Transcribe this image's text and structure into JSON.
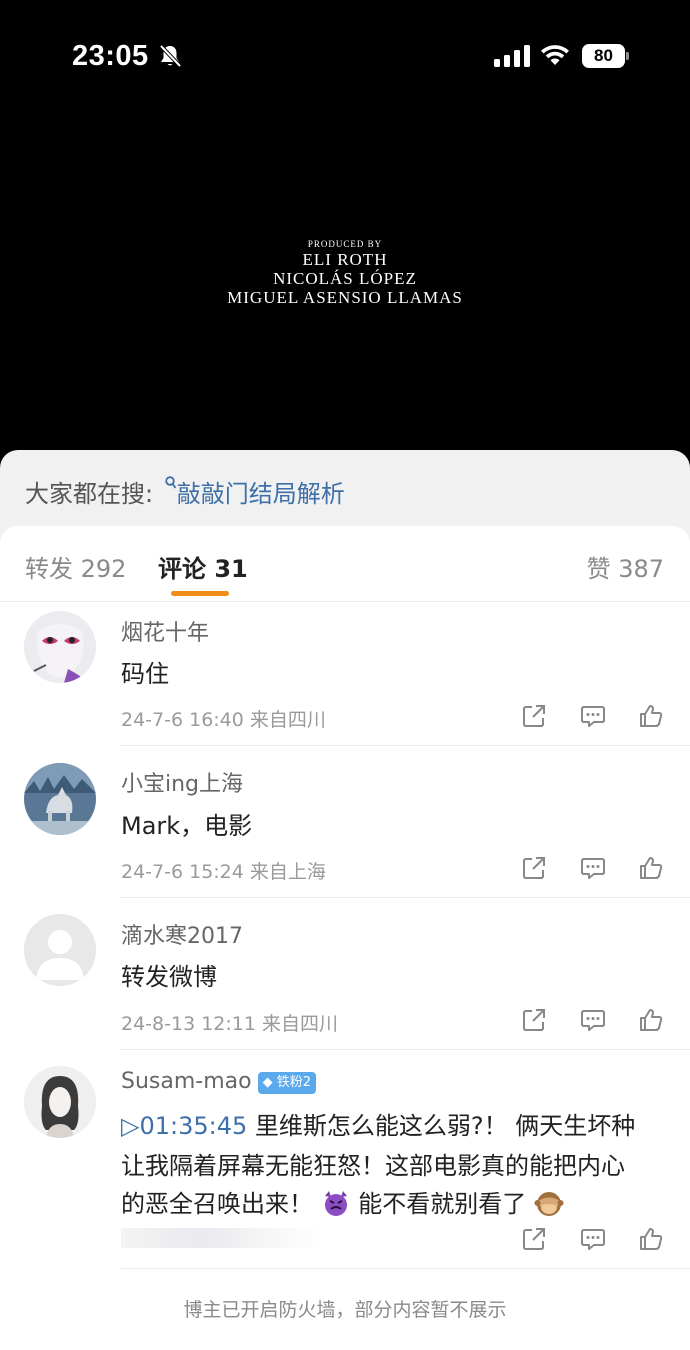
{
  "status_bar": {
    "time": "23:05",
    "battery": "80"
  },
  "video": {
    "credit_heading": "PRODUCED BY",
    "credit_lines": [
      "ELI ROTH",
      "NICOLÁS LÓPEZ",
      "MIGUEL ASENSIO LLAMAS"
    ]
  },
  "search_hint": {
    "label": "大家都在搜:",
    "query": "敲敲门结局解析"
  },
  "tabs": {
    "repost": "转发 292",
    "comments": "评论 31",
    "likes": "赞 387"
  },
  "comments": [
    {
      "user": "烟花十年",
      "text": "码住",
      "meta": "24-7-6 16:40  来自四川"
    },
    {
      "user": "小宝ing上海",
      "text": "Mark，电影",
      "meta": "24-7-6 15:24  来自上海"
    },
    {
      "user": "滴水寒2017",
      "text": "转发微博",
      "meta": "24-8-13 12:11  来自四川"
    },
    {
      "user": "Susam-mao",
      "badge": "铁粉2",
      "timestamp": "01:35:45",
      "line1": "里维斯怎么能这么弱?！ 俩天生坏种",
      "line2": "让我隔着屏幕无能狂怒！这部电影真的能把内心",
      "line3a": "的恶全召唤出来！",
      "line3b": "能不看就别看了"
    }
  ],
  "footer_note": "博主已开启防火墙，部分内容暂不展示",
  "colors": {
    "accent": "#f08c18",
    "link": "#3e6fa8",
    "badge": "#5aa9ec"
  }
}
